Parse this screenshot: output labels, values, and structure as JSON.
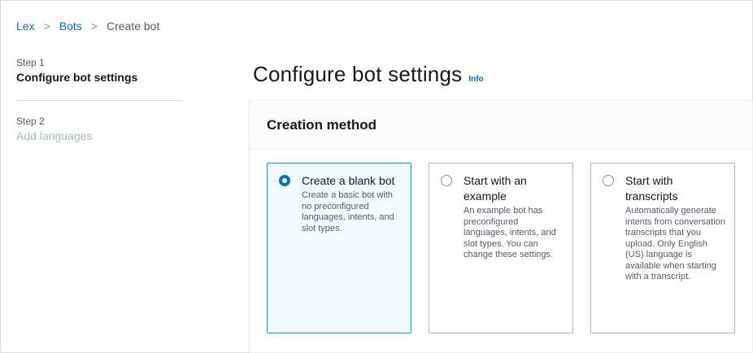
{
  "breadcrumb": {
    "items": [
      "Lex",
      "Bots"
    ],
    "separator": ">",
    "current": "Create bot"
  },
  "steps": [
    {
      "number": "Step 1",
      "title": "Configure bot settings"
    },
    {
      "number": "Step 2",
      "title": "Add languages"
    }
  ],
  "page": {
    "title": "Configure bot settings",
    "info_link": "Info"
  },
  "creation_method": {
    "heading": "Creation method",
    "options": [
      {
        "title": "Create a blank bot",
        "description": "Create a basic bot with no preconfigured languages, intents, and slot types.",
        "selected": true
      },
      {
        "title": "Start with an example",
        "description": "An example bot has preconfigured languages, intents, and slot types. You can change these settings.",
        "selected": false
      },
      {
        "title": "Start with transcripts",
        "description": "Automatically generate intents from conversation transcripts that you upload. Only English (US) language is available when starting with a transcript.",
        "selected": false
      }
    ]
  },
  "colors": {
    "link": "#0073bb",
    "selected_border": "#00a1c9",
    "selected_bg": "#f1faff"
  }
}
